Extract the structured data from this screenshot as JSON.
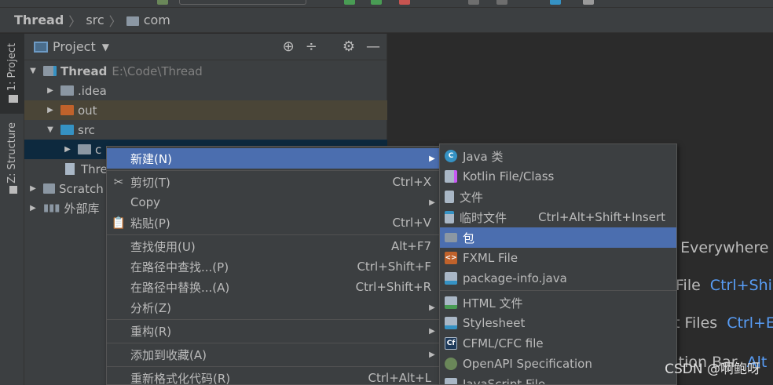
{
  "breadcrumb": {
    "project": "Thread",
    "src": "src",
    "com": "com"
  },
  "stripe": {
    "project_tab": "1: Project",
    "structure_tab": "Z: Structure"
  },
  "panel": {
    "title": "Project"
  },
  "tree": {
    "root_name": "Thread",
    "root_path": "E:\\Code\\Thread",
    "idea": ".idea",
    "out": "out",
    "src": "src",
    "com_partial": "c",
    "thread_file_partial": "Thre",
    "scratch_partial": "Scratch",
    "ext_libs": "外部库"
  },
  "menu": {
    "new": "新建(N)",
    "cut": "剪切(T)",
    "cut_sc": "Ctrl+X",
    "copy": "Copy",
    "paste": "粘贴(P)",
    "paste_sc": "Ctrl+V",
    "find_usages": "查找使用(U)",
    "find_usages_sc": "Alt+F7",
    "find_in_path": "在路径中查找...(P)",
    "find_in_path_sc": "Ctrl+Shift+F",
    "replace_in_path": "在路径中替换...(A)",
    "replace_in_path_sc": "Ctrl+Shift+R",
    "analyze": "分析(Z)",
    "refactor": "重构(R)",
    "add_favorites": "添加到收藏(A)",
    "reformat": "重新格式化代码(R)",
    "reformat_sc": "Ctrl+Alt+L"
  },
  "submenu": {
    "java_class": "Java 类",
    "kotlin": "Kotlin File/Class",
    "file": "文件",
    "scratch": "临时文件",
    "scratch_sc": "Ctrl+Alt+Shift+Insert",
    "package": "包",
    "fxml": "FXML File",
    "package_info": "package-info.java",
    "html": "HTML 文件",
    "stylesheet": "Stylesheet",
    "cfml": "CFML/CFC file",
    "openapi": "OpenAPI Specification",
    "javascript": "JavaScript File"
  },
  "editor_hints": {
    "h1": "n Everywhere",
    "h2": "File",
    "h2_key": "Ctrl+Shi",
    "h3": "t Files",
    "h3_key": "Ctrl+E",
    "h4": "ation Bar",
    "h4_key": "Alt"
  },
  "watermark": "CSDN @啊鲍呀",
  "colors": {
    "highlight": "#4b6eaf",
    "background": "#2b2b2b",
    "panel": "#3c3f41",
    "key": "#589df6"
  }
}
